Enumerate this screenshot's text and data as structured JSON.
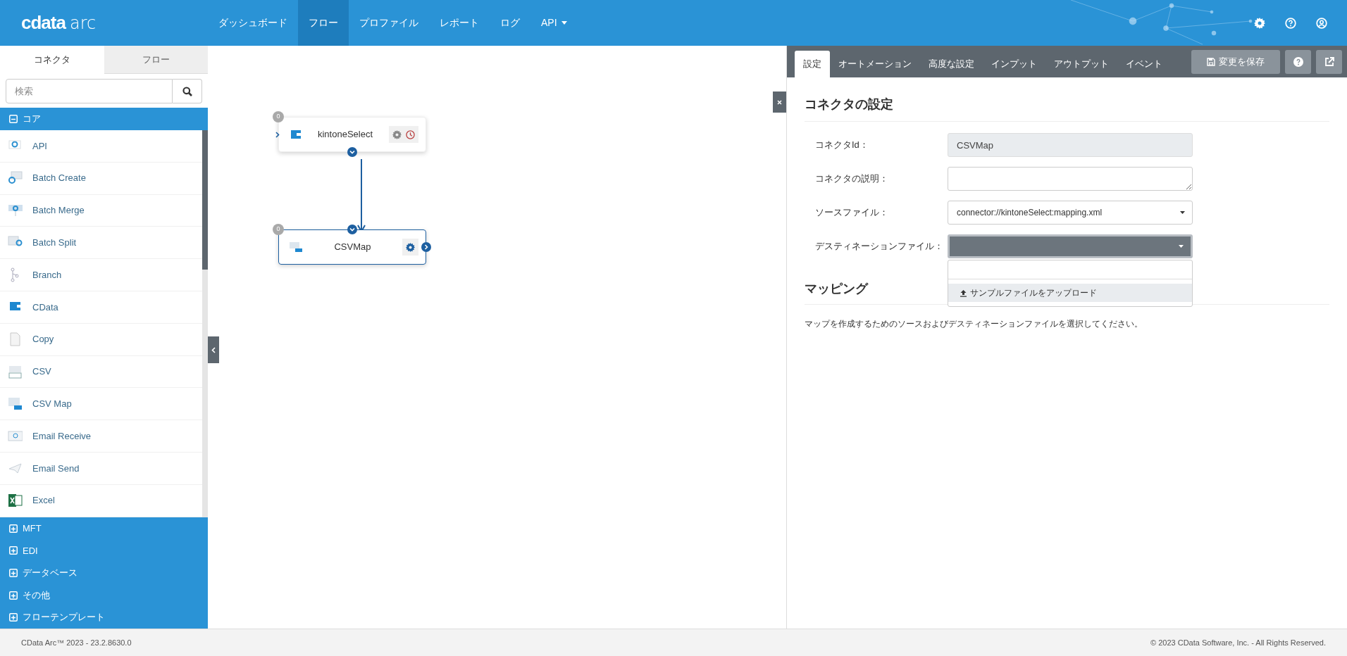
{
  "header": {
    "logo_mark": "cdata",
    "logo_product": "arc",
    "nav": [
      {
        "label": "ダッシュボード",
        "selected": false,
        "kind": "link"
      },
      {
        "label": "フロー",
        "selected": true,
        "kind": "link"
      },
      {
        "label": "プロファイル",
        "selected": false,
        "kind": "link"
      },
      {
        "label": "レポート",
        "selected": false,
        "kind": "link"
      },
      {
        "label": "ログ",
        "selected": false,
        "kind": "link"
      },
      {
        "label": "API",
        "selected": false,
        "kind": "dropdown"
      }
    ]
  },
  "sidebar": {
    "tabs": [
      {
        "label": "コネクタ",
        "selected": true
      },
      {
        "label": "フロー",
        "selected": false
      }
    ],
    "search": {
      "placeholder": "検索"
    },
    "groups": [
      {
        "label": "コア",
        "expanded": true,
        "items": [
          "API",
          "Batch Create",
          "Batch Merge",
          "Batch Split",
          "Branch",
          "CData",
          "Copy",
          "CSV",
          "CSV Map",
          "Email Receive",
          "Email Send",
          "Excel"
        ]
      },
      {
        "label": "MFT",
        "expanded": false
      },
      {
        "label": "EDI",
        "expanded": false
      },
      {
        "label": "データベース",
        "expanded": false
      },
      {
        "label": "その他",
        "expanded": false
      },
      {
        "label": "フローテンプレート",
        "expanded": false
      }
    ]
  },
  "canvas": {
    "nodes": [
      {
        "name": "kintoneSelect",
        "count": "0",
        "kind": "source",
        "selected": false
      },
      {
        "name": "CSVMap",
        "count": "0",
        "kind": "map",
        "selected": true
      }
    ]
  },
  "panel": {
    "tabs": [
      {
        "label": "設定",
        "selected": true
      },
      {
        "label": "オートメーション",
        "selected": false
      },
      {
        "label": "高度な設定",
        "selected": false
      },
      {
        "label": "インプット",
        "selected": false
      },
      {
        "label": "アウトプット",
        "selected": false
      },
      {
        "label": "イベント",
        "selected": false
      }
    ],
    "save_button": "変更を保存",
    "heading": "コネクタの設定",
    "fields": [
      {
        "label": "コネクタId：",
        "kind": "text",
        "value": "CSVMap",
        "disabled": true
      },
      {
        "label": "コネクタの説明：",
        "kind": "textarea"
      },
      {
        "label": "ソースファイル：",
        "kind": "select",
        "value": "connector://kintoneSelect:mapping.xml",
        "expanded": false
      },
      {
        "label": "デスティネーションファイル：",
        "kind": "select",
        "expanded": true,
        "options": [
          "サンプルファイルをアップロード"
        ]
      }
    ],
    "mapping_heading": "マッピング",
    "mapping_hint": "マップを作成するためのソースおよびデスティネーションファイルを選択してください。"
  },
  "footer": {
    "version": "CData Arc™ 2023 - 23.2.8630.0",
    "copyright": "© 2023 CData Software, Inc. - All Rights Reserved."
  }
}
